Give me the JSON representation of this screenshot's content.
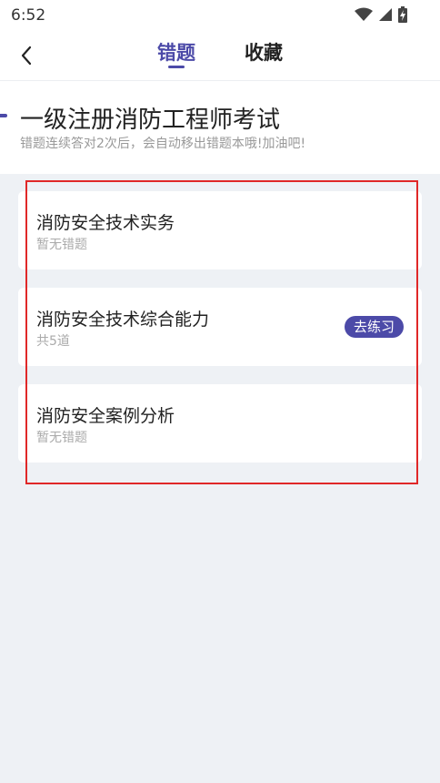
{
  "status_bar": {
    "time": "6:52"
  },
  "nav": {
    "tabs": [
      {
        "label": "错题",
        "active": true
      },
      {
        "label": "收藏",
        "active": false
      }
    ]
  },
  "exam": {
    "title": "一级注册消防工程师考试",
    "subtitle": "错题连续答对2次后，会自动移出错题本哦!加油吧!"
  },
  "subjects": [
    {
      "name": "消防安全技术实务",
      "status": "暂无错题"
    },
    {
      "name": "消防安全技术综合能力",
      "status": "共5道",
      "action_label": "去练习"
    },
    {
      "name": "消防安全案例分析",
      "status": "暂无错题"
    }
  ],
  "colors": {
    "accent": "#4c4aa8",
    "highlight": "#e02828"
  }
}
